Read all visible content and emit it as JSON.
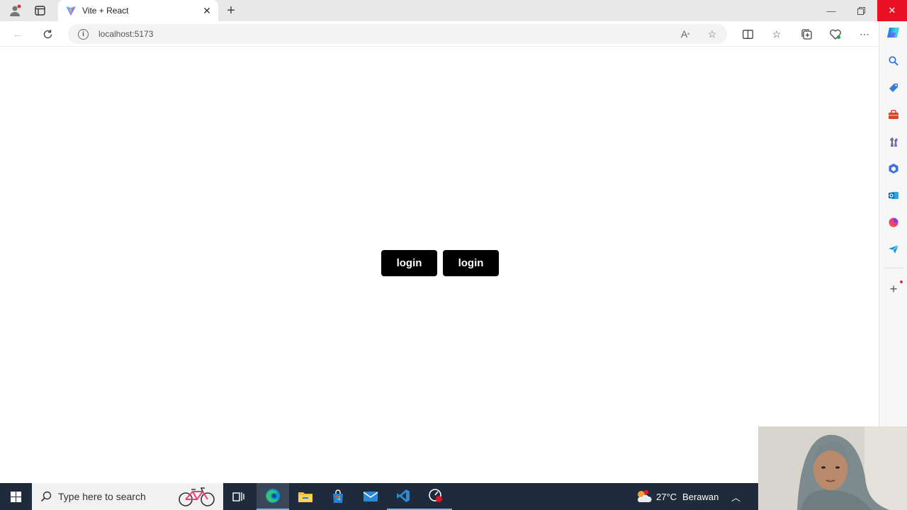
{
  "browser": {
    "tab": {
      "title": "Vite + React"
    },
    "address": {
      "url": "localhost:5173"
    }
  },
  "page": {
    "buttons": [
      {
        "label": "login"
      },
      {
        "label": "login"
      }
    ]
  },
  "taskbar": {
    "search_placeholder": "Type here to search",
    "weather": {
      "temperature": "27°C",
      "condition": "Berawan"
    }
  },
  "colors": {
    "button_bg": "#000000",
    "button_text": "#ffffff",
    "close_red": "#e81123",
    "taskbar_bg": "#1f2b3a"
  },
  "icons": {
    "tabbar": [
      "profile-icon",
      "workspaces-icon",
      "vite-favicon",
      "close-icon",
      "new-tab-icon"
    ],
    "window": [
      "minimize-icon",
      "restore-icon",
      "close-icon"
    ],
    "nav": [
      "back-icon",
      "refresh-icon",
      "info-icon",
      "read-aloud-icon",
      "favorite-star-icon",
      "split-screen-icon",
      "favorites-icon",
      "collections-icon",
      "browser-essentials-icon",
      "more-icon",
      "copilot-icon"
    ],
    "sidebar": [
      "search-icon",
      "shopping-icon",
      "tools-icon",
      "games-icon",
      "microsoft365-icon",
      "outlook-icon",
      "designer-icon",
      "send-icon",
      "add-icon"
    ],
    "taskbar": [
      "windows-start-icon",
      "search-icon",
      "task-view-icon",
      "edge-icon",
      "file-explorer-icon",
      "store-icon",
      "mail-icon",
      "vscode-icon",
      "record-icon",
      "weather-icon",
      "chevron-up-icon"
    ]
  }
}
